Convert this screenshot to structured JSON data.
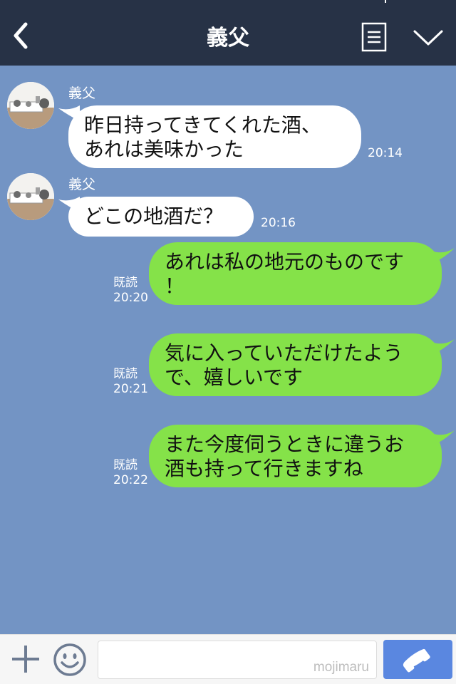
{
  "header": {
    "title": "義父",
    "back_icon": "chevron-left-icon",
    "menu_icon": "list-menu-icon",
    "collapse_icon": "chevron-down-icon"
  },
  "messages": [
    {
      "direction": "in",
      "sender": "義父",
      "lines": [
        "昨日持ってきてくれた酒、",
        "あれは美味かった"
      ],
      "time": "20:14"
    },
    {
      "direction": "in",
      "sender": "義父",
      "lines": [
        "どこの地酒だ？"
      ],
      "time": "20:16"
    },
    {
      "direction": "out",
      "read": "既読",
      "lines": [
        "あれは私の地元のものです",
        "！"
      ],
      "time": "20:20"
    },
    {
      "direction": "out",
      "read": "既読",
      "lines": [
        "気に入っていただけたよう",
        "で、嬉しいです"
      ],
      "time": "20:21"
    },
    {
      "direction": "out",
      "read": "既読",
      "lines": [
        "また今度伺うときに違うお",
        "酒も持って行きますね"
      ],
      "time": "20:22"
    }
  ],
  "input": {
    "placeholder": "",
    "watermark": "mojimaru",
    "plus_icon": "plus-icon",
    "emoji_icon": "emoji-icon",
    "call_icon": "phone-icon"
  },
  "colors": {
    "header_bg": "#273246",
    "chat_bg": "#7394c4",
    "incoming_bubble": "#ffffff",
    "outgoing_bubble": "#85e249",
    "call_button": "#5a87e0"
  }
}
